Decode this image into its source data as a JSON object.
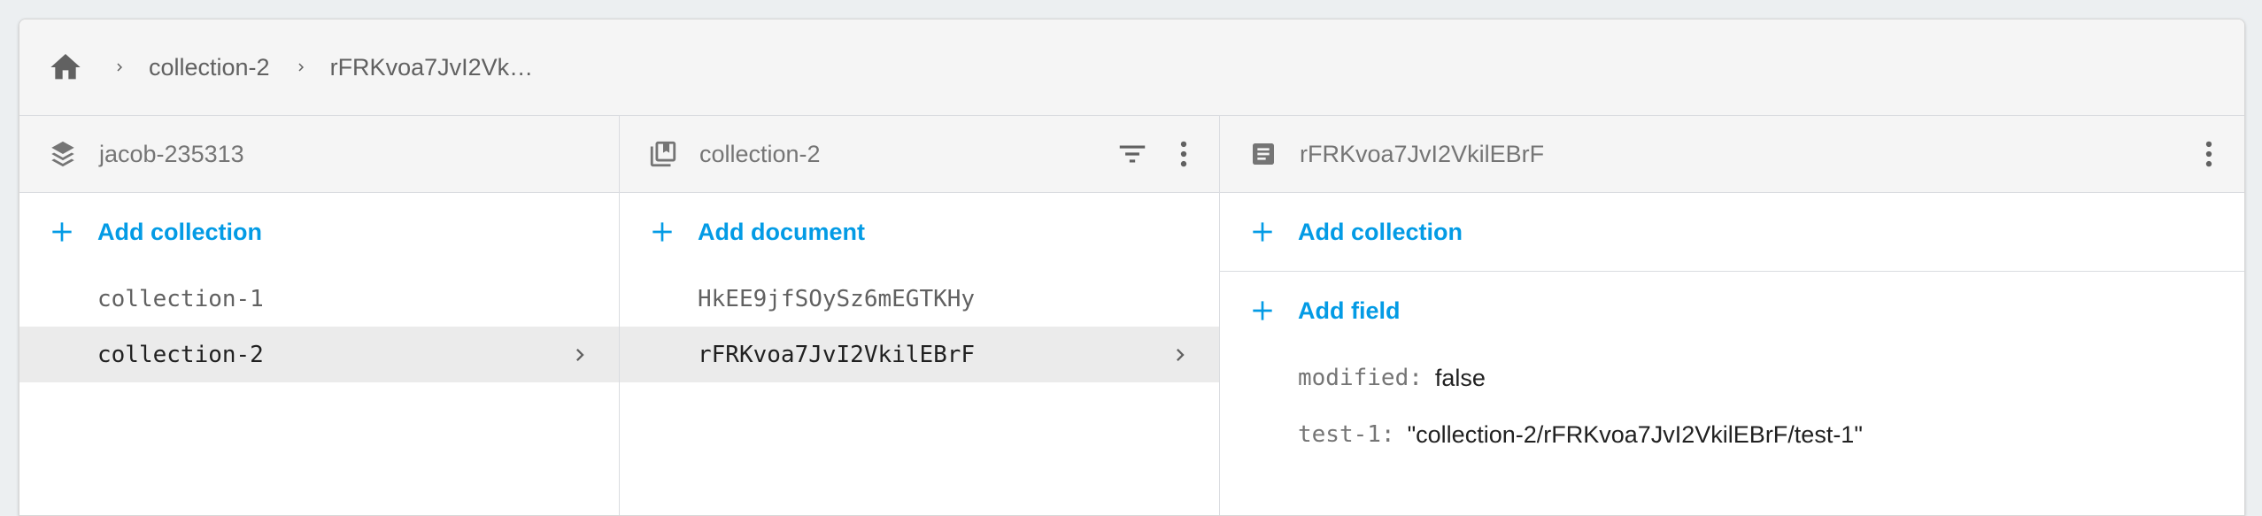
{
  "breadcrumb": {
    "home_icon": "home-icon",
    "items": [
      "collection-2",
      "rFRKvoa7JvI2Vk…"
    ]
  },
  "panes": {
    "root": {
      "title": "jacob-235313",
      "icon": "database-layers-icon",
      "add_label": "Add collection",
      "items": [
        "collection-1",
        "collection-2"
      ],
      "selected": "collection-2"
    },
    "collection": {
      "title": "collection-2",
      "icon": "collection-icon",
      "add_label": "Add document",
      "items": [
        "HkEE9jfSOySz6mEGTKHy",
        "rFRKvoa7JvI2VkilEBrF"
      ],
      "selected": "rFRKvoa7JvI2VkilEBrF"
    },
    "document": {
      "title": "rFRKvoa7JvI2VkilEBrF",
      "icon": "document-icon",
      "add_collection_label": "Add collection",
      "add_field_label": "Add field",
      "fields": [
        {
          "key": "modified",
          "value": "false"
        },
        {
          "key": "test-1",
          "value": "\"collection-2/rFRKvoa7JvI2VkilEBrF/test-1\""
        }
      ]
    }
  },
  "colors": {
    "accent": "#039be5",
    "header_bg": "#f5f5f5",
    "selected_bg": "#ebebeb",
    "page_bg": "#eceff1"
  }
}
